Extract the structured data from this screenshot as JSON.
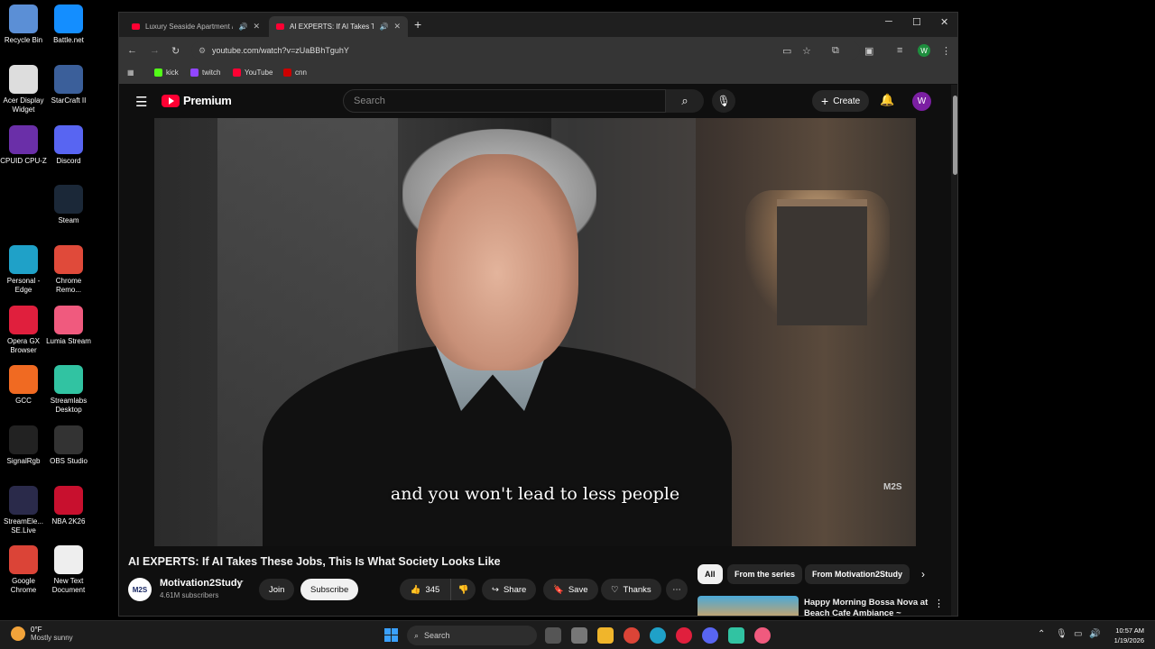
{
  "desktop": {
    "icons": [
      {
        "label": "Recycle Bin",
        "color": "#5b8fd6"
      },
      {
        "label": "Battle.net",
        "color": "#148eff"
      },
      {
        "label": "Acer Display Widget",
        "color": "#ddd"
      },
      {
        "label": "StarCraft II",
        "color": "#3b5f9a"
      },
      {
        "label": "CPUID CPU-Z",
        "color": "#6a2fa8"
      },
      {
        "label": "Discord",
        "color": "#5865f2"
      },
      {
        "label": "Steam",
        "color": "#1b2838"
      },
      {
        "label": "Personal - Edge",
        "color": "#1fa1c8"
      },
      {
        "label": "Chrome Remo...",
        "color": "#e04a3a"
      },
      {
        "label": "Opera GX Browser",
        "color": "#e01f3d"
      },
      {
        "label": "Lumia Stream",
        "color": "#f05a7e"
      },
      {
        "label": "GCC",
        "color": "#f06a22"
      },
      {
        "label": "Streamlabs Desktop",
        "color": "#31c3a2"
      },
      {
        "label": "SignalRgb",
        "color": "#222"
      },
      {
        "label": "OBS Studio",
        "color": "#333"
      },
      {
        "label": "StreamEle... SE.Live",
        "color": "#2a2a4a"
      },
      {
        "label": "NBA 2K26",
        "color": "#c8102e"
      },
      {
        "label": "Google Chrome",
        "color": "#db4437"
      },
      {
        "label": "New Text Document",
        "color": "#eee"
      }
    ]
  },
  "browser": {
    "tabs": [
      {
        "title": "Luxury Seaside Apartment /",
        "active": false
      },
      {
        "title": "AI EXPERTS: If AI Takes The:",
        "active": true
      }
    ],
    "new_tab": "+",
    "window_controls": {
      "minimize": "─",
      "maximize": "☐",
      "close": "✕"
    },
    "url": "youtube.com/watch?v=zUaBBhTguhY",
    "bookmarks": [
      {
        "label": "kick",
        "color": "#53fc18"
      },
      {
        "label": "twitch",
        "color": "#9146ff"
      },
      {
        "label": "YouTube",
        "color": "#ff0033"
      },
      {
        "label": "cnn",
        "color": "#cc0000"
      }
    ],
    "profile_initial": "W"
  },
  "youtube": {
    "logo_text": "Premium",
    "search_placeholder": "Search",
    "create_label": "Create",
    "avatar_initial": "W",
    "video": {
      "caption": "and you won't lead to less people",
      "watermark": "M2S"
    },
    "title": "AI EXPERTS: If AI Takes These Jobs, This Is What Society Looks Like",
    "channel": {
      "name": "Motivation2Study",
      "subscribers": "4.61M subscribers",
      "avatar_text": "M2S"
    },
    "actions": {
      "join": "Join",
      "subscribe": "Subscribe",
      "likes": "345",
      "share": "Share",
      "save": "Save",
      "thanks": "Thanks",
      "more": "⋯"
    },
    "chips": [
      "All",
      "From the series",
      "From Motivation2Study"
    ],
    "recommendation": {
      "title": "Happy Morning Bossa Nova at Beach Cafe Ambiance ~"
    }
  },
  "taskbar": {
    "weather_temp": "0°F",
    "weather_desc": "Mostly sunny",
    "search_label": "Search",
    "time": "10:57 AM",
    "date": "1/19/2026"
  }
}
